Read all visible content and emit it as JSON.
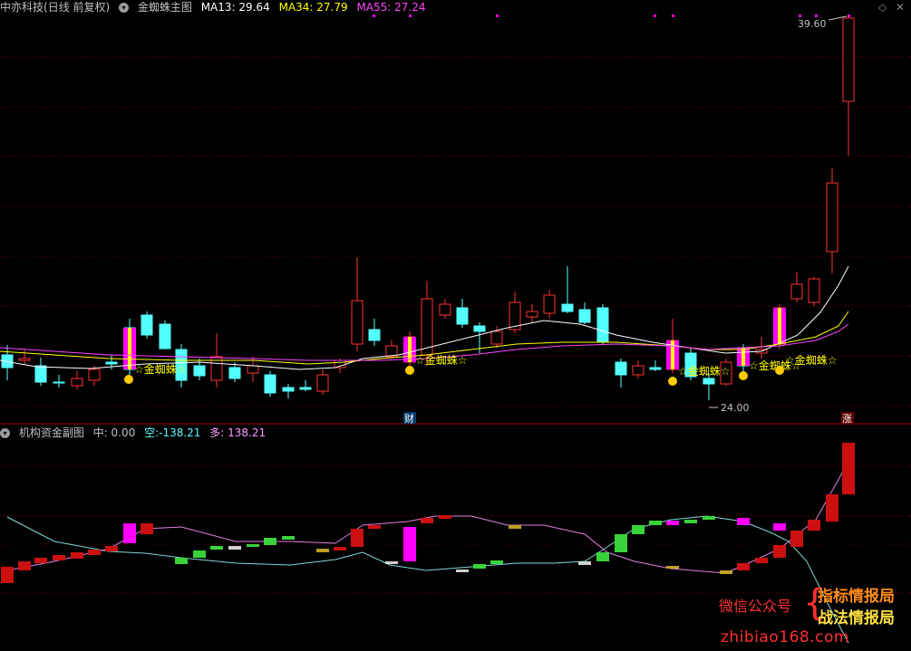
{
  "header": {
    "stock_name": "中亦科技",
    "period": "(日线 前复权)",
    "indicator": "金蜘蛛主图",
    "ma13": "MA13: 29.64",
    "ma34": "MA34: 27.79",
    "ma55": "MA55: 27.24"
  },
  "sub_header": {
    "indicator": "机构资金副图",
    "zhong": "中: 0.00",
    "kong": "空:-138.21",
    "duo": "多: 138.21"
  },
  "annotations": {
    "high_price": "39.60",
    "low_price": "24.00",
    "signal_label": "金蜘蛛",
    "cai_badge": "财",
    "zhang_badge": "涨"
  },
  "watermark": {
    "prefix": "微信公众号",
    "line1": "指标情报局",
    "line2": "战法情报局",
    "url": "zhibiao168.com"
  },
  "colors": {
    "up": "#ff3232",
    "down": "#54ffff",
    "ma13": "#ffffff",
    "ma34": "#ffff00",
    "ma55": "#ff44ff",
    "signal": "#ff00ff",
    "grid": "#7a0000"
  },
  "chart_data": {
    "type": "candlestick",
    "price_annotations": {
      "max": 39.6,
      "min": 24.0
    },
    "ma_values": {
      "MA13": 29.64,
      "MA34": 27.79,
      "MA55": 27.24
    },
    "sub_values": {
      "中": 0.0,
      "空": -138.21,
      "多": 138.21
    }
  }
}
